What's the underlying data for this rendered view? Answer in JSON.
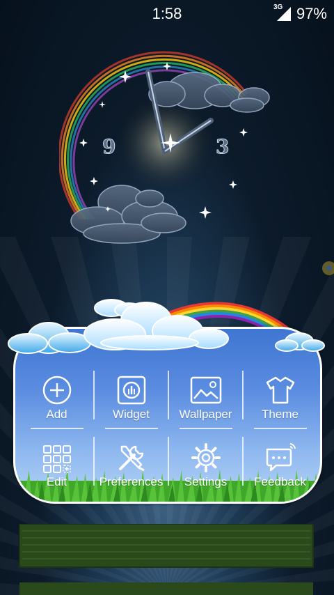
{
  "status_bar": {
    "time": "1:58",
    "network": "3G",
    "battery": "97%"
  },
  "clock_widget": {
    "numeral_left": "9",
    "numeral_right": "3"
  },
  "menu": {
    "items": [
      {
        "label": "Add",
        "icon": "add-circle-icon"
      },
      {
        "label": "Widget",
        "icon": "widget-icon"
      },
      {
        "label": "Wallpaper",
        "icon": "wallpaper-icon"
      },
      {
        "label": "Theme",
        "icon": "theme-shirt-icon"
      },
      {
        "label": "Edit",
        "icon": "edit-grid-icon"
      },
      {
        "label": "Preferences",
        "icon": "preferences-tools-icon"
      },
      {
        "label": "Settings",
        "icon": "settings-gear-icon"
      },
      {
        "label": "Feedback",
        "icon": "feedback-bubble-icon"
      }
    ]
  },
  "colors": {
    "panel_top": "#3f76d2",
    "panel_bottom": "#b7d4f6",
    "panel_border": "#ffffff",
    "grass": "#3fa82a",
    "background": "#0c1b2b"
  }
}
